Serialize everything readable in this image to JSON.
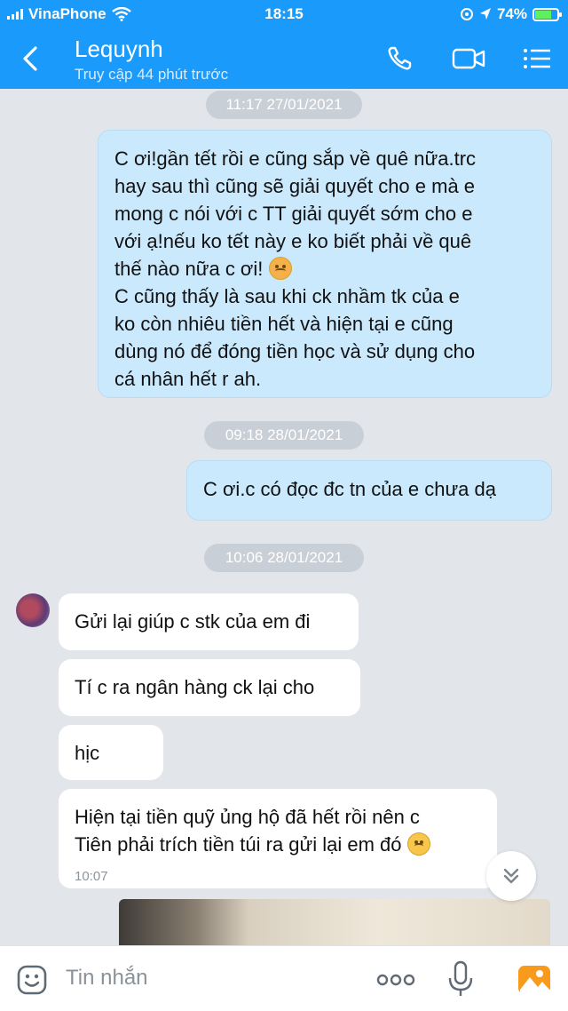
{
  "status_bar": {
    "carrier": "VinaPhone",
    "time": "18:15",
    "battery": "74%",
    "battery_level": 0.74
  },
  "header": {
    "contact_name": "Lequynh",
    "last_seen": "Truy cập 44 phút trước"
  },
  "colors": {
    "header_blue": "#1a9bfc",
    "outgoing_bubble": "#cbe9fc",
    "incoming_bubble": "#ffffff",
    "chat_background": "#e2e6ea",
    "accent_orange": "#f89b1c"
  },
  "conversation": {
    "stamps": [
      "11:17 27/01/2021",
      "09:18 28/01/2021",
      "10:06 28/01/2021"
    ],
    "outgoing": [
      {
        "lines": [
          "C ơi!gần tết rồi e cũng sắp về quê nữa.trc",
          "hay sau thì cũng sẽ giải quyết cho e mà e",
          "mong c nói với c TT giải quyết sớm cho e",
          "với ạ!nếu ko tết này e ko biết phải về quê",
          "thế nào nữa c ơi!",
          "C cũng thấy là sau khi ck nhầm tk của e",
          "ko còn nhiêu tiền hết và hiện tại e cũng",
          "dùng nó để đóng tiền học và sử dụng cho",
          "cá nhân hết r ah."
        ],
        "emoji": "angry-face-emoji"
      },
      {
        "text": "C ơi.c có đọc đc tn của e chưa dạ"
      }
    ],
    "incoming": [
      {
        "text": "Gửi lại giúp c stk của em đi"
      },
      {
        "text": "Tí c ra ngân hàng ck lại cho"
      },
      {
        "text": "hịc"
      },
      {
        "lines": [
          "Hiện tại tiền quỹ ủng hộ đã hết rồi nên c",
          "Tiên phải trích tiền túi ra gửi lại em đó"
        ],
        "emoji": "sad-face-emoji",
        "time": "10:07"
      }
    ]
  },
  "input_bar": {
    "placeholder": "Tin nhắn",
    "icons": [
      "sticker-icon",
      "more-icon",
      "microphone-icon",
      "image-icon"
    ]
  }
}
